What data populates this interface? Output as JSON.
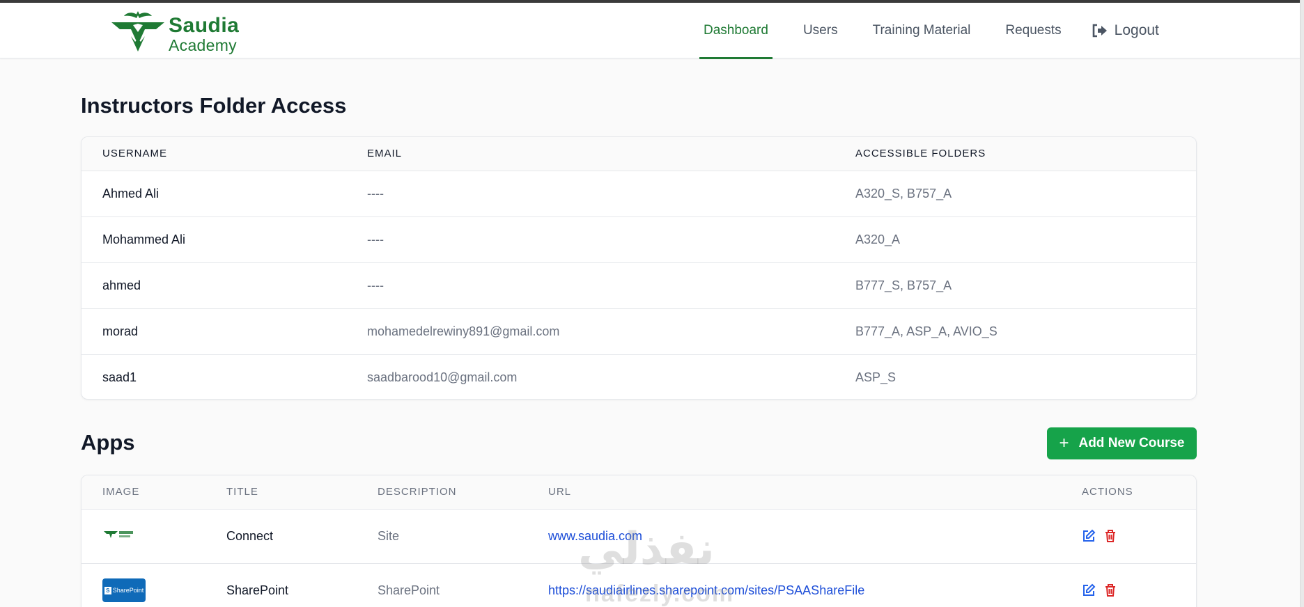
{
  "brand": {
    "name_line1": "Saudia",
    "name_line2": "Academy",
    "color": "#1f7a34"
  },
  "nav": {
    "items": [
      {
        "label": "Dashboard",
        "active": true
      },
      {
        "label": "Users",
        "active": false
      },
      {
        "label": "Training Material",
        "active": false
      },
      {
        "label": "Requests",
        "active": false
      }
    ],
    "logout_label": "Logout",
    "logout_icon": "logout-icon"
  },
  "instructors": {
    "title": "Instructors Folder Access",
    "columns": [
      "USERNAME",
      "EMAIL",
      "ACCESSIBLE FOLDERS"
    ],
    "rows": [
      {
        "username": "Ahmed Ali",
        "email": "----",
        "folders": "A320_S, B757_A"
      },
      {
        "username": "Mohammed Ali",
        "email": "----",
        "folders": "A320_A"
      },
      {
        "username": "ahmed",
        "email": "----",
        "folders": "B777_S, B757_A"
      },
      {
        "username": "morad",
        "email": "mohamedelrewiny891@gmail.com",
        "folders": "B777_A, ASP_A, AVIO_S"
      },
      {
        "username": "saad1",
        "email": "saadbarood10@gmail.com",
        "folders": "ASP_S"
      }
    ]
  },
  "apps": {
    "title": "Apps",
    "add_button_label": "Add New Course",
    "add_button_color": "#16a34a",
    "columns": [
      "IMAGE",
      "TITLE",
      "DESCRIPTION",
      "URL",
      "ACTIONS"
    ],
    "rows": [
      {
        "image": "saudia-academy-logo-thumbnail",
        "title": "Connect",
        "description": "Site",
        "url": "www.saudia.com"
      },
      {
        "image": "sharepoint-thumbnail",
        "image_text": "SharePoint",
        "title": "SharePoint",
        "description": "SharePoint",
        "url": "https://saudiairlines.sharepoint.com/sites/PSAAShareFile"
      }
    ],
    "action_icons": [
      "edit-icon",
      "delete-icon"
    ]
  },
  "watermark": {
    "text_arabic": "نفذلي",
    "text_latin": "nafezly.com"
  }
}
